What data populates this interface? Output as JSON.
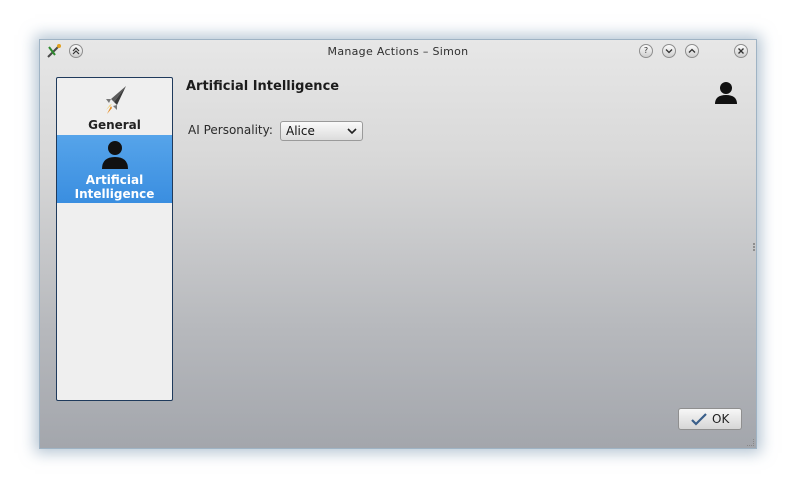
{
  "window": {
    "title": "Manage Actions – Simon",
    "buttons": {
      "help": "?",
      "minimize": "⌄",
      "maximize": "⌃",
      "close": "✕",
      "shade": "⌃"
    }
  },
  "sidebar": {
    "items": [
      {
        "label": "General",
        "icon": "rocket-icon",
        "selected": false
      },
      {
        "label_line1": "Artificial",
        "label_line2": "Intelligence",
        "icon": "person-silhouette-icon",
        "selected": true
      }
    ]
  },
  "content": {
    "title": "Artificial Intelligence",
    "header_icon": "person-silhouette-icon",
    "personality_label": "AI Personality:",
    "personality_value": "Alice"
  },
  "footer": {
    "ok_label": "OK"
  },
  "colors": {
    "selection": "#4a9ae6",
    "sidebar_border": "#1f3a5c"
  }
}
